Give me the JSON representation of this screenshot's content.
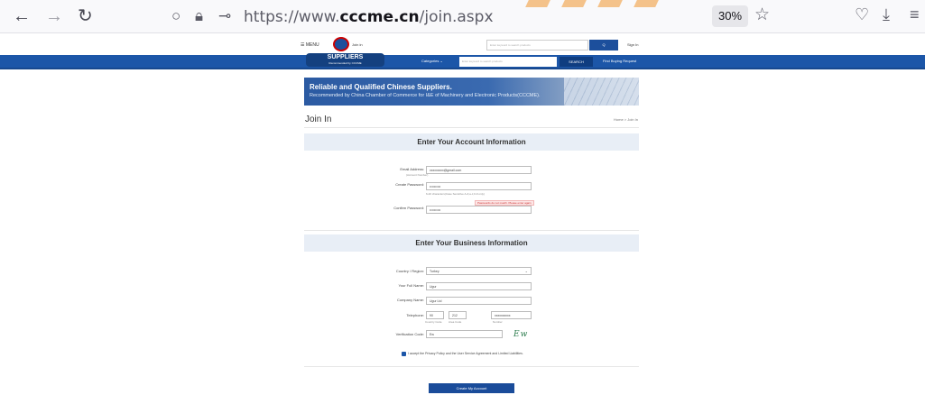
{
  "browser": {
    "url_prefix": "https://www.",
    "url_domain": "cccme.cn",
    "url_path": "/join.aspx",
    "zoom": "30%",
    "back_icon": "←",
    "forward_icon": "→",
    "reload_icon": "↻"
  },
  "site_top": {
    "menu_label": "MENU",
    "join_label": "Join in",
    "search_placeholder": "Enter keyword to search products",
    "search_button": "Q",
    "signin": "Sign In"
  },
  "nav_bar": {
    "suppliers_title": "SUPPLIERS",
    "suppliers_sub": "Recommended by CCCME",
    "categories": "Categories",
    "search_placeholder": "Enter keyword to search products",
    "search_button": "SEARCH",
    "find_buying": "Find Buying Request"
  },
  "banner": {
    "title": "Reliable and Qualified Chinese Suppliers.",
    "subtitle": "Recommended by China Chamber of Commerce for I&E of Machinery and Electronic Products(CCCME)."
  },
  "page": {
    "title": "Join In",
    "breadcrumb": "Home > Join In"
  },
  "account": {
    "heading": "Enter Your Account Information",
    "email_label": "Email Address:",
    "email_sub": "(Account Number)",
    "email_value": "xxxxxxxxx@gmail.com",
    "password_label": "Create Password:",
    "password_value": "••••••••••",
    "password_hint": "6-20 characters(Case Sensitive A-Z,a-z,0-9 only)",
    "password_error": "Passwords do not match. Please enter again",
    "confirm_label": "Confirm Password:",
    "confirm_value": "••••••••••"
  },
  "business": {
    "heading": "Enter Your Business Information",
    "country_label": "Country / Region:",
    "country_value": "Turkey",
    "name_label": "Your Full Name:",
    "name_value": "Ugur",
    "company_label": "Company Name:",
    "company_value": "Ugur Ltd",
    "phone_label": "Telephone:",
    "phone_country": "90",
    "phone_area": "212",
    "phone_number": "xxxxxxxxxx",
    "phone_sub_country": "Country Code",
    "phone_sub_area": "Area Code",
    "phone_sub_number": "Number",
    "verification_label": "Verification Code:",
    "verification_value": "Ew",
    "captcha_text": "Ew"
  },
  "agreement": {
    "text": "I accept the Privacy Policy and the User Service Agreement and Limited Liabilities."
  },
  "submit": {
    "label": "Create My Account"
  }
}
